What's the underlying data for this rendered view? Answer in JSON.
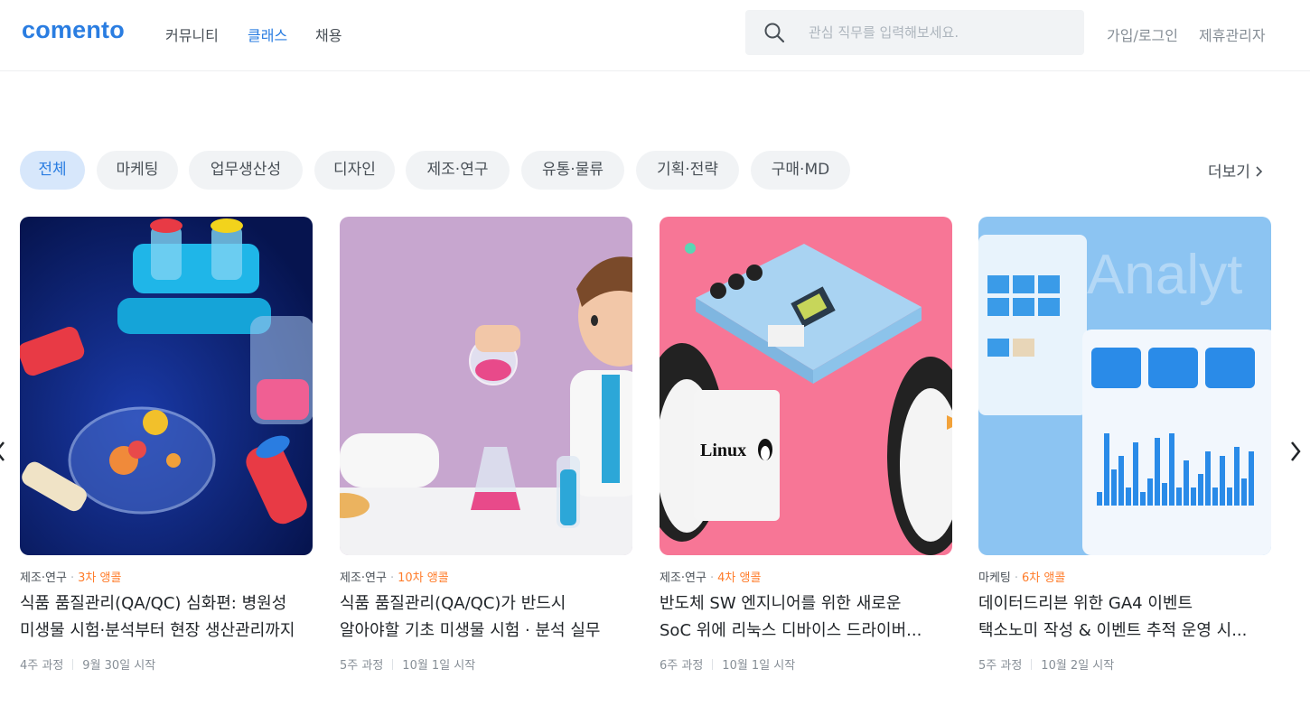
{
  "header": {
    "logo": "comento",
    "nav": [
      "커뮤니티",
      "클래스",
      "채용"
    ],
    "search_placeholder": "관심 직무를 입력해보세요.",
    "links": [
      "가입/로그인",
      "제휴관리자"
    ]
  },
  "categories": [
    "전체",
    "마케팅",
    "업무생산성",
    "디자인",
    "제조·연구",
    "유통·물류",
    "기획·전략",
    "구매·MD"
  ],
  "more_label": "더보기",
  "cards": [
    {
      "category": "제조·연구",
      "cohort": "3차 앵콜",
      "title_lines": [
        "식품 품질관리(QA/QC) 심화편: 병원성",
        "미생물 시험·분석부터 현장 생산관리까지"
      ],
      "duration": "4주 과정",
      "start": "9월 30일 시작"
    },
    {
      "category": "제조·연구",
      "cohort": "10차 앵콜",
      "title_lines": [
        "식품 품질관리(QA/QC)가 반드시",
        "알아야할 기초 미생물 시험 · 분석 실무"
      ],
      "duration": "5주 과정",
      "start": "10월 1일 시작"
    },
    {
      "category": "제조·연구",
      "cohort": "4차 앵콜",
      "title_lines": [
        "반도체 SW 엔지니어를 위한 새로운",
        "SoC 위에 리눅스 디바이스 드라이버..."
      ],
      "duration": "6주 과정",
      "start": "10월 1일 시작",
      "image_text": "Linux"
    },
    {
      "category": "마케팅",
      "cohort": "6차 앵콜",
      "title_lines": [
        "데이터드리븐 위한 GA4 이벤트",
        "택소노미 작성 & 이벤트 추적 운영 시..."
      ],
      "duration": "5주 과정",
      "start": "10월 2일 시작",
      "image_text": "Analyt"
    }
  ],
  "colors": {
    "brand": "#2a7de1",
    "cohort": "#ff7c2a",
    "chip_bg": "#f1f3f5",
    "chip_active_bg": "#d7e7fb"
  },
  "icons": [
    "search-icon",
    "chevron-right-icon",
    "chevron-left-icon"
  ]
}
